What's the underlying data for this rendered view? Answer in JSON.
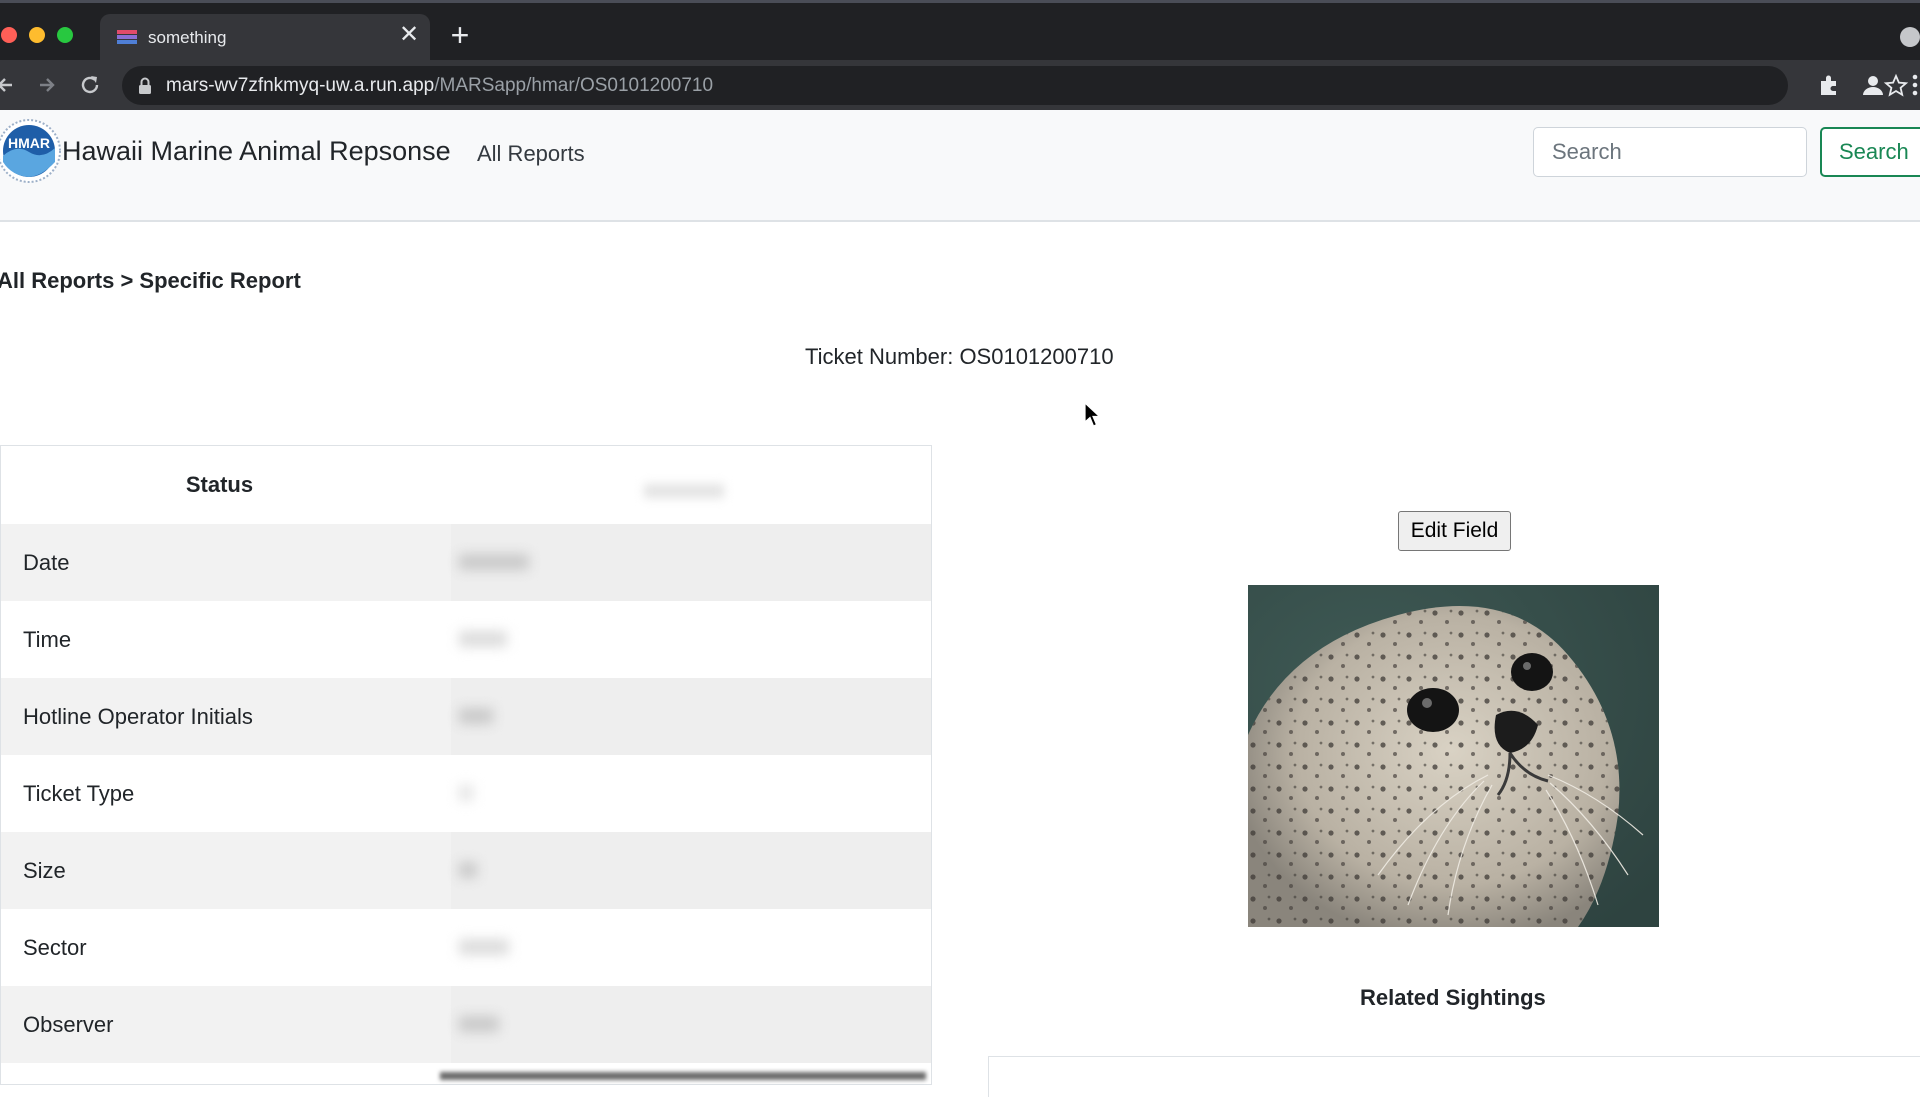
{
  "browser": {
    "tab_title": "something",
    "url_host": "mars-wv7zfnkmyq-uw.a.run.app",
    "url_path": "/MARSapp/hmar/OS0101200710",
    "new_tab_label": "+",
    "close_tab_label": "✕"
  },
  "navbar": {
    "logo_text": "HMAR",
    "brand": "Hawaii Marine Animal Repsonse",
    "links": [
      "All Reports"
    ],
    "search_placeholder": "Search",
    "search_button": "Search"
  },
  "breadcrumb": "All Reports > Specific Report",
  "ticket_text": "Ticket Number: OS0101200710",
  "report_table": {
    "header": "Status",
    "rows": [
      "Date",
      "Time",
      "Hotline Operator Initials",
      "Ticket Type",
      "Size",
      "Sector",
      "Observer"
    ]
  },
  "edit_button": "Edit Field",
  "related_heading": "Related Sightings",
  "colors": {
    "success": "#198754",
    "navbar_bg": "#f8f9fa",
    "chrome_dark": "#202124"
  }
}
